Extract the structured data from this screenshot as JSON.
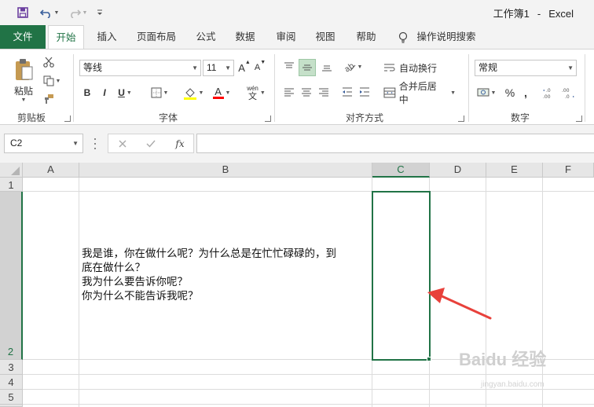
{
  "quick_access": {
    "save_icon": "save-icon",
    "undo_icon": "undo-icon",
    "redo_icon": "redo-icon",
    "customize_icon": "customize-quick-access-icon"
  },
  "window": {
    "workbook": "工作簿1",
    "separator": "-",
    "app": "Excel"
  },
  "tabs": {
    "file": "文件",
    "home": "开始",
    "insert": "插入",
    "page_layout": "页面布局",
    "formulas": "公式",
    "data": "数据",
    "review": "审阅",
    "view": "视图",
    "help": "帮助",
    "tell_me": "操作说明搜索"
  },
  "ribbon": {
    "clipboard": {
      "paste_label": "粘贴",
      "group_label": "剪贴板"
    },
    "font": {
      "font_name": "等线",
      "font_size": "11",
      "bold": "B",
      "italic": "I",
      "underline": "U",
      "font_color_glyph": "A",
      "phonetic_glyph_top": "wén",
      "phonetic_glyph_bottom": "文",
      "grow_glyph": "A",
      "shrink_glyph": "A",
      "highlight_color": "#ffff00",
      "font_color": "#ff0000",
      "group_label": "字体"
    },
    "alignment": {
      "wrap_text": "自动换行",
      "merge_center": "合并后居中",
      "group_label": "对齐方式"
    },
    "number": {
      "format": "常规",
      "percent": "%",
      "comma": ",",
      "group_label": "数字"
    }
  },
  "formula_bar": {
    "name_box": "C2",
    "cancel_icon": "cancel-icon",
    "enter_icon": "check-icon",
    "fx_label": "fx",
    "formula": ""
  },
  "grid": {
    "columns": [
      "A",
      "B",
      "C",
      "D",
      "E",
      "F"
    ],
    "rows": [
      "1",
      "2",
      "3",
      "4",
      "5"
    ],
    "selected_column": "C",
    "selected_row": "2",
    "cell_b2_lines": [
      "我是谁，你在做什么呢？为什么总是在忙忙碌碌的，到",
      "底在做什么？",
      "我为什么要告诉你呢？",
      "你为什么不能告诉我呢？"
    ]
  },
  "annotation": {
    "arrow_color": "#e8413b"
  },
  "watermark": {
    "brand": "Baidu 经验",
    "url": "jingyan.baidu.com"
  },
  "colors": {
    "excel_green": "#217346",
    "header_gray": "#e6e6e6",
    "selected_header": "#d2d2d2"
  }
}
